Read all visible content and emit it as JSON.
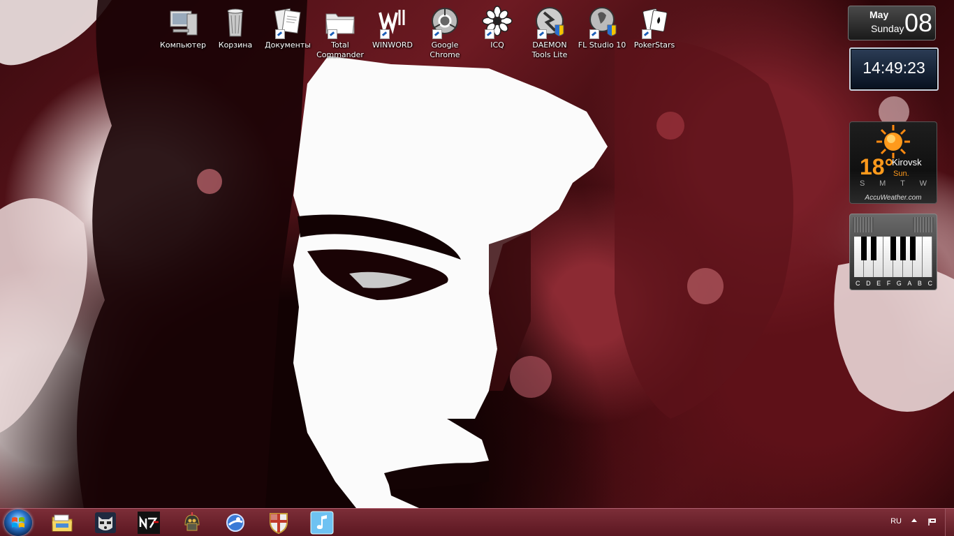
{
  "desktop": {
    "icons": [
      {
        "label": "Компьютер",
        "icon": "computer-icon",
        "shortcut": false
      },
      {
        "label": "Корзина",
        "icon": "recycle-bin-icon",
        "shortcut": false
      },
      {
        "label": "Документы",
        "icon": "documents-icon",
        "shortcut": true
      },
      {
        "label": "Total Commander",
        "icon": "total-commander-icon",
        "shortcut": true
      },
      {
        "label": "WINWORD",
        "icon": "winword-icon",
        "shortcut": true
      },
      {
        "label": "Google Chrome",
        "icon": "chrome-icon",
        "shortcut": true
      },
      {
        "label": "ICQ",
        "icon": "icq-icon",
        "shortcut": true
      },
      {
        "label": "DAEMON Tools Lite",
        "icon": "daemon-tools-icon",
        "shortcut": true
      },
      {
        "label": "FL Studio 10",
        "icon": "fl-studio-icon",
        "shortcut": true
      },
      {
        "label": "PokerStars",
        "icon": "pokerstars-icon",
        "shortcut": true
      }
    ]
  },
  "gadgets": {
    "calendar": {
      "month": "May",
      "weekday": "Sunday",
      "day": "08"
    },
    "clock": {
      "time": "14:49:23"
    },
    "weather": {
      "temperature": "18°",
      "city": "Kirovsk",
      "day": "Sun.",
      "week": [
        "S",
        "M",
        "T",
        "W"
      ],
      "brand": "AccuWeather.com"
    },
    "piano": {
      "notes": [
        "C",
        "D",
        "E",
        "F",
        "G",
        "A",
        "B",
        "C"
      ]
    }
  },
  "taskbar": {
    "pinned": [
      "file-explorer-icon",
      "raccoon-app-icon",
      "n7-mass-effect-icon",
      "fallout-helmet-icon",
      "search-globe-icon",
      "shield-cross-icon",
      "music-note-app-icon"
    ],
    "language": "RU"
  },
  "colors": {
    "taskbar": "#6b202b",
    "accent": "#ff9a1c"
  }
}
